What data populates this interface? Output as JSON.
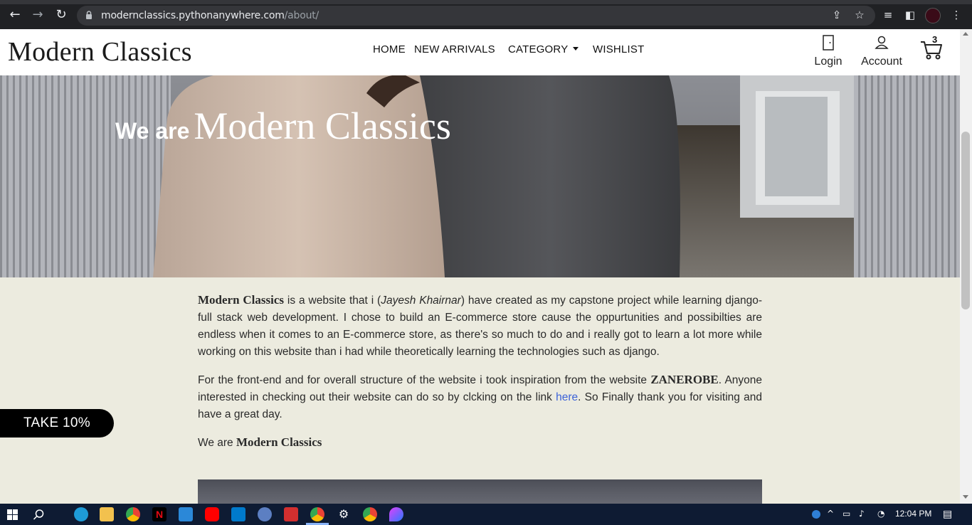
{
  "browser": {
    "url_host": "modernclassics.pythonanywhere.com",
    "url_path": "/about/"
  },
  "site": {
    "brand": "Modern Classics",
    "nav": {
      "home": "HOME",
      "new_arrivals": "NEW ARRIVALS",
      "category": "CATEGORY",
      "wishlist": "WISHLIST"
    },
    "login_label": "Login",
    "account_label": "Account",
    "cart_count": "3"
  },
  "hero": {
    "prefix": "We are",
    "title": "Modern Classics"
  },
  "about": {
    "p1_brand": "Modern Classics",
    "p1_a": " is a website that i (",
    "p1_name": "Jayesh Khairnar",
    "p1_b": ") have created as my capstone project while learning django-full stack web development. I chose to build an E-commerce store cause the oppurtunities and possibilties are endless when it comes to an E-commerce store, as there's so much to do and i really got to learn a lot more while working on this website than i had while theoretically learning the technologies such as django.",
    "p2_a": "For the front-end and for overall structure of the website i took inspiration from the website ",
    "p2_brand": "ZANEROBE",
    "p2_b": ". Anyone interested in checking out their website can do so by clcking on the link ",
    "p2_link": "here",
    "p2_c": ". So Finally thank you for visiting and have a great day.",
    "p3_a": "We are ",
    "p3_brand": "Modern Classics"
  },
  "promo": {
    "label": "TAKE 10%"
  },
  "taskbar": {
    "time": "12:04 PM"
  },
  "colors": {
    "page_bg": "#ecebdf",
    "link": "#3d63d8",
    "chrome_bg": "#202124",
    "taskbar_bg": "#0e1b33"
  }
}
